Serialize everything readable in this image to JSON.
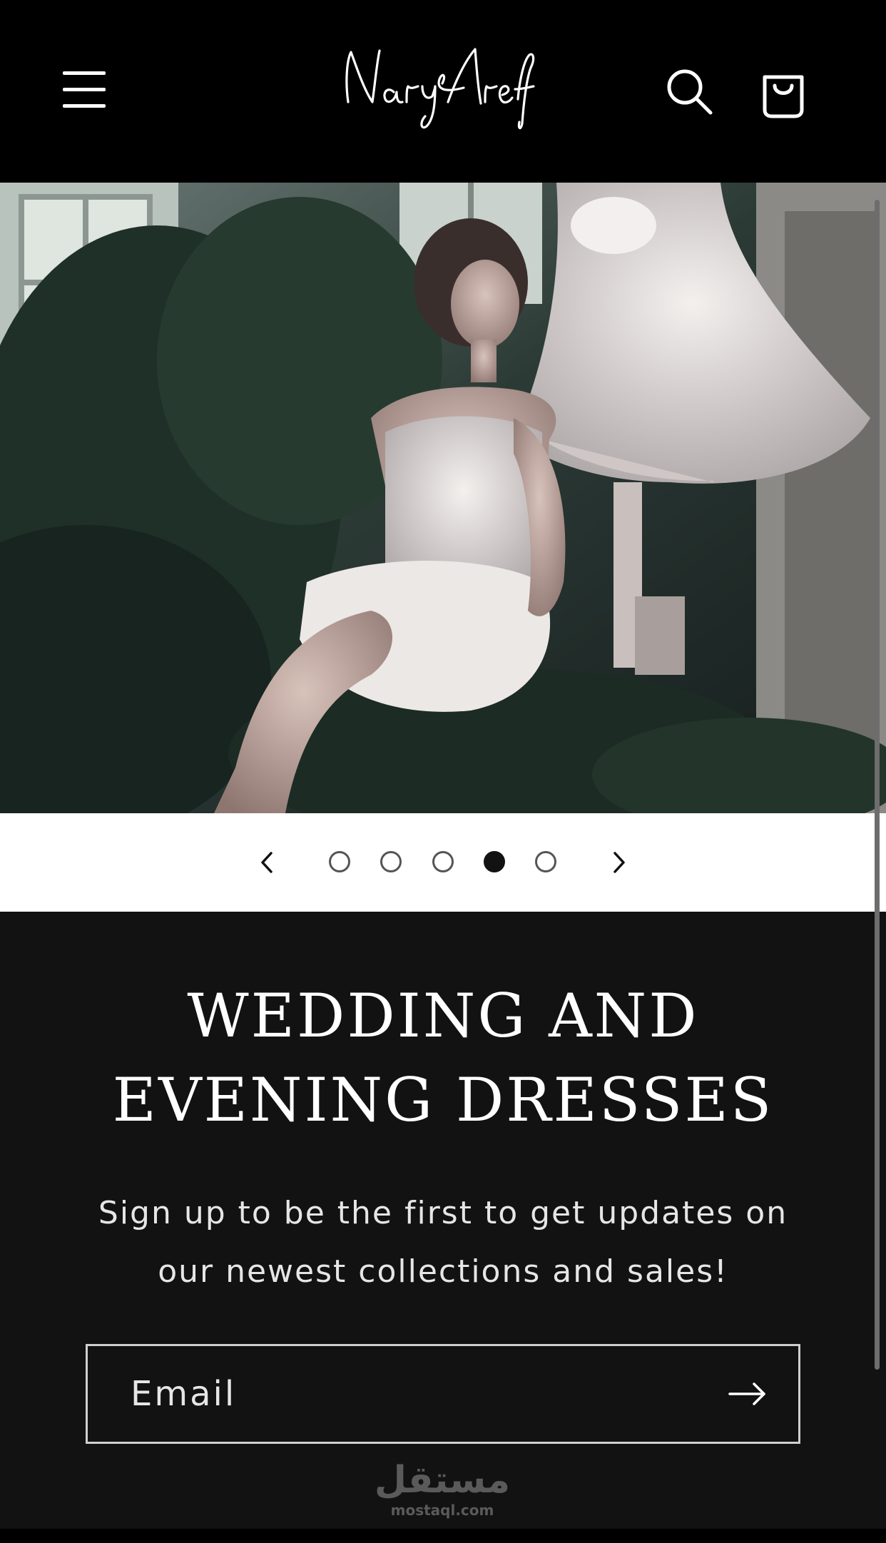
{
  "header": {
    "logo_text": "Nary Aref",
    "menu_icon": "hamburger-menu-icon",
    "search_icon": "search-icon",
    "cart_icon": "shopping-bag-icon"
  },
  "hero": {
    "slides_total": 5,
    "active_slide": 4
  },
  "slider": {
    "prev_icon": "chevron-left-icon",
    "next_icon": "chevron-right-icon"
  },
  "newsletter": {
    "headline_line1": "WEDDING AND",
    "headline_line2": "EVENING DRESSES",
    "subtext_line1": "Sign up to be the first to get updates on",
    "subtext_line2": "our newest collections and sales!",
    "email_placeholder": "Email",
    "submit_icon": "arrow-right-icon"
  },
  "watermark": {
    "arabic": "مستقل",
    "latin": "mostaql.com"
  },
  "colors": {
    "header_bg": "#000000",
    "newsletter_bg": "#121212",
    "controls_bg": "#ffffff",
    "active_dot": "#121212"
  }
}
